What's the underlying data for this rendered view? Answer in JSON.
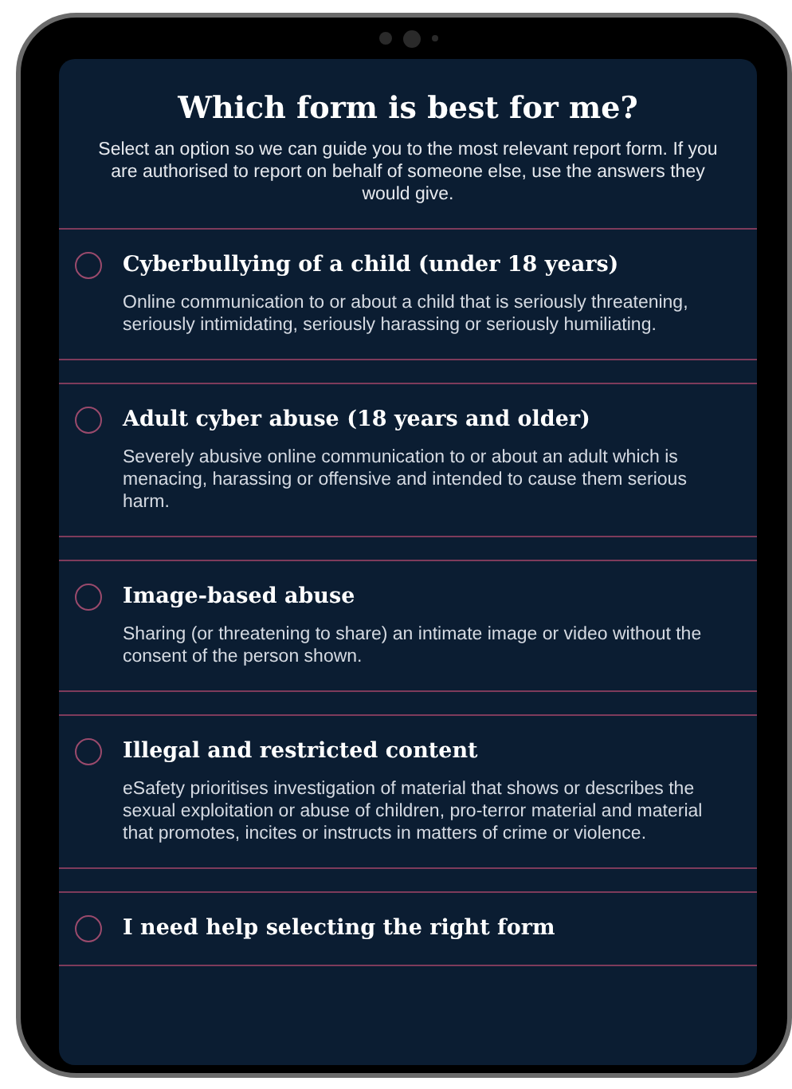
{
  "header": {
    "title": "Which form is best for me?",
    "intro": "Select an option so we can guide you to the most relevant report form. If you are authorised to report on behalf of someone else, use the answers they would give."
  },
  "options": [
    {
      "title": "Cyberbullying of a child (under 18 years)",
      "description": "Online communication to or about a child that is seriously threatening, seriously intimidating, seriously harassing or seriously humiliating.",
      "selected": false
    },
    {
      "title": "Adult cyber abuse (18 years and older)",
      "description": "Severely abusive online communication to or about an adult which is menacing, harassing or offensive and intended to cause them serious harm.",
      "selected": false
    },
    {
      "title": "Image-based abuse",
      "description": "Sharing (or threatening to share) an intimate image or video without the consent of the person shown.",
      "selected": false
    },
    {
      "title": "Illegal and restricted content",
      "description": "eSafety prioritises investigation of material that shows or describes the sexual exploitation or abuse of children, pro-terror material and material that promotes, incites or instructs in matters of crime or violence.",
      "selected": false
    },
    {
      "title": "I need help selecting the right form",
      "selected": false
    }
  ]
}
